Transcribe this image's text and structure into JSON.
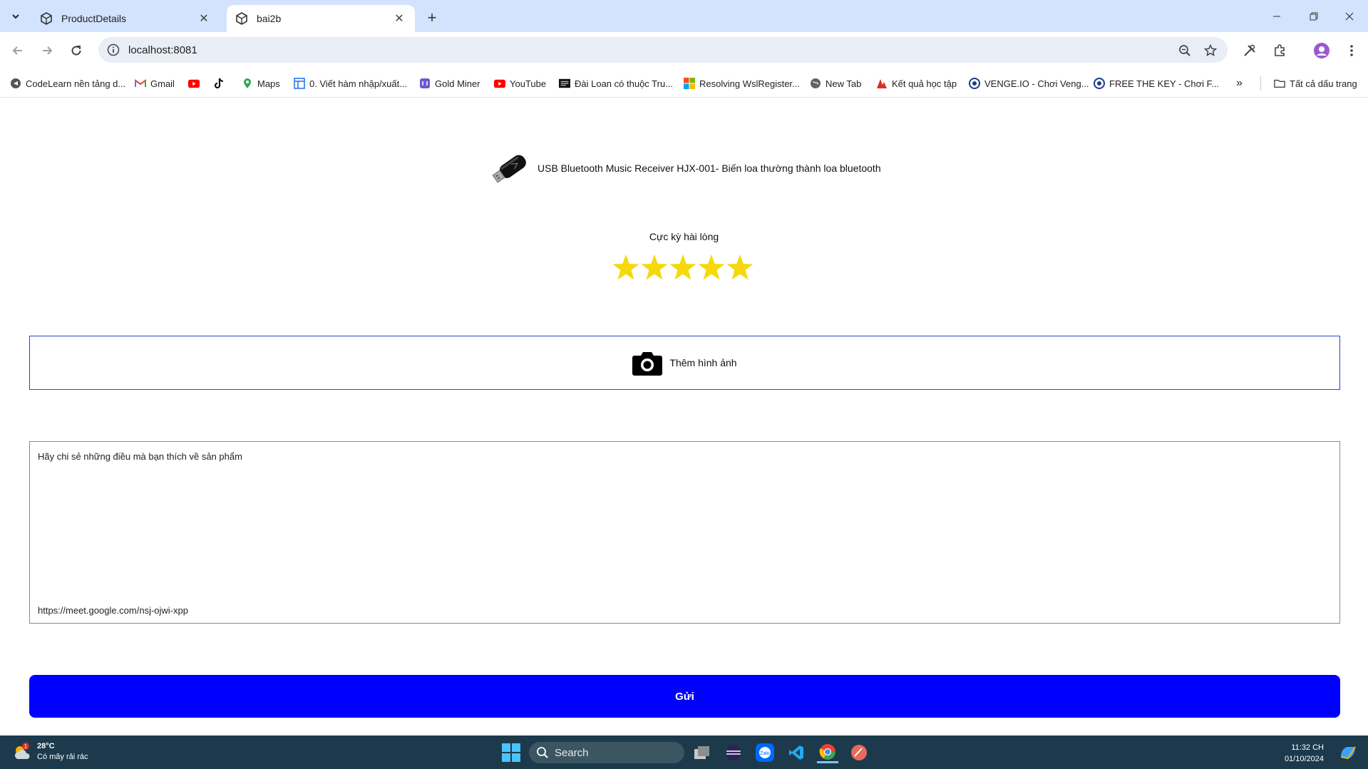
{
  "browser": {
    "tabs": [
      {
        "title": "ProductDetails",
        "active": false
      },
      {
        "title": "bai2b",
        "active": true
      }
    ],
    "url": "localhost:8081",
    "bookmarks": [
      {
        "label": "CodeLearn nền tảng d...",
        "icon": "codelearn-icon"
      },
      {
        "label": "Gmail",
        "icon": "gmail-icon"
      },
      {
        "label": "",
        "icon": "youtube-icon"
      },
      {
        "label": "",
        "icon": "tiktok-icon"
      },
      {
        "label": "Maps",
        "icon": "maps-icon"
      },
      {
        "label": "0. Viết hàm nhập/xuất...",
        "icon": "doc-icon"
      },
      {
        "label": "Gold Miner",
        "icon": "game-icon"
      },
      {
        "label": "YouTube",
        "icon": "youtube-icon"
      },
      {
        "label": "Đài Loan có thuộc Tru...",
        "icon": "news-icon"
      },
      {
        "label": "Resolving WslRegister...",
        "icon": "microsoft-icon"
      },
      {
        "label": "New Tab",
        "icon": "globe-icon"
      },
      {
        "label": "Kết quả học tập",
        "icon": "school-icon"
      },
      {
        "label": "VENGE.IO - Chơi Veng...",
        "icon": "venge-icon"
      },
      {
        "label": "FREE THE KEY - Chơi F...",
        "icon": "venge-icon"
      }
    ],
    "all_bookmarks_label": "Tất cả dấu trang"
  },
  "page": {
    "product_name": "USB Bluetooth Music Receiver HJX-001- Biến loa thường thành loa bluetooth",
    "rating_label": "Cực kỳ hài lòng",
    "rating": {
      "value": 5,
      "max": 5
    },
    "star_color": "#f5d90a",
    "add_photo_label": "Thêm hình ảnh",
    "comment_placeholder": "Hãy chi sẻ những điều mà bạn thích về sản phẩm",
    "comment_link": "https://meet.google.com/nsj-ojwi-xpp",
    "send_label": "Gửi",
    "send_color": "#0000ff"
  },
  "taskbar": {
    "temperature": "28°C",
    "weather_desc": "Có mây rải rác",
    "weather_badge": "1",
    "search_label": "Search",
    "time": "11:32 CH",
    "date": "01/10/2024"
  }
}
